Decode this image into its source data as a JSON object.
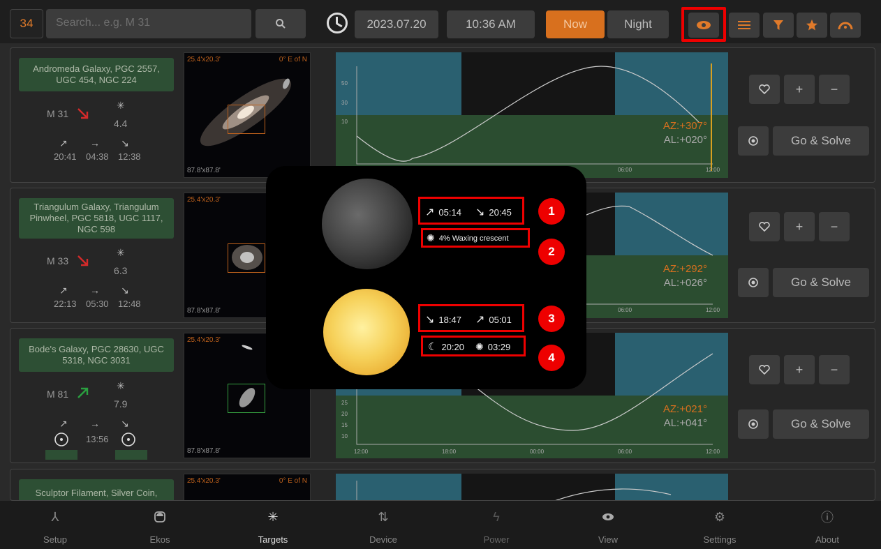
{
  "topbar": {
    "count": "34",
    "search_placeholder": "Search... e.g. M 31",
    "date": "2023.07.20",
    "time": "10:36 AM",
    "now_label": "Now",
    "night_label": "Night",
    "icons": [
      "eye-icon",
      "list-icon",
      "filter-icon",
      "star-icon",
      "horizon-icon"
    ]
  },
  "rows": [
    {
      "name": "Andromeda Galaxy, PGC 2557, UGC 454, NGC 224",
      "catalog": "M 31",
      "magnitude": "4.4",
      "rise": "20:41",
      "transit": "04:38",
      "set": "12:38",
      "fov": "25.4'x20.3'",
      "angle": "0° E of N",
      "fov2": "87.8'x87.8'",
      "az": "AZ:+307°",
      "al": "AL:+020°",
      "ticks": [
        "06:00",
        "12:00"
      ],
      "y_ticks": [
        "50",
        "30",
        "10"
      ],
      "go_label": "Go & Solve"
    },
    {
      "name": "Triangulum Galaxy, Triangulum Pinwheel, PGC 5818, UGC 1117, NGC 598",
      "catalog": "M 33",
      "magnitude": "6.3",
      "rise": "22:13",
      "transit": "05:30",
      "set": "12:48",
      "fov": "25.4'x20.3'",
      "fov2": "87.8'x87.8'",
      "az": "AZ:+292°",
      "al": "AL:+026°",
      "ticks": [
        "06:00",
        "12:00"
      ],
      "go_label": "Go & Solve"
    },
    {
      "name": "Bode's Galaxy, PGC 28630, UGC 5318, NGC 3031",
      "catalog": "M 81",
      "magnitude": "7.9",
      "transit": "13:56",
      "fov": "25.4'x20.3'",
      "fov2": "87.8'x87.8'",
      "az": "AZ:+021°",
      "al": "AL:+041°",
      "ticks": [
        "12:00",
        "18:00",
        "00:00",
        "06:00",
        "12:00"
      ],
      "y_ticks": [
        "25",
        "20",
        "15",
        "10"
      ],
      "go_label": "Go & Solve"
    },
    {
      "name": "Sculptor Filament, Silver Coin,",
      "fov": "25.4'x20.3'",
      "angle": "0° E of N"
    }
  ],
  "popup": {
    "moon_rise": "05:14",
    "moon_set": "20:45",
    "moon_phase": "4% Waxing crescent",
    "sun_set": "18:47",
    "sun_rise": "05:01",
    "dusk": "20:20",
    "dawn": "03:29",
    "badges": [
      "1",
      "2",
      "3",
      "4"
    ]
  },
  "nav": [
    {
      "label": "Setup",
      "icon": "setup-icon"
    },
    {
      "label": "Ekos",
      "icon": "ekos-icon"
    },
    {
      "label": "Targets",
      "icon": "targets-icon"
    },
    {
      "label": "Device",
      "icon": "device-icon"
    },
    {
      "label": "Power",
      "icon": "power-icon"
    },
    {
      "label": "View",
      "icon": "view-icon"
    },
    {
      "label": "Settings",
      "icon": "settings-icon"
    },
    {
      "label": "About",
      "icon": "about-icon"
    }
  ],
  "colors": {
    "accent": "#d8701e",
    "highlight": "#e00000",
    "name_bg": "#2d4f34",
    "sky": "#2a6070"
  }
}
